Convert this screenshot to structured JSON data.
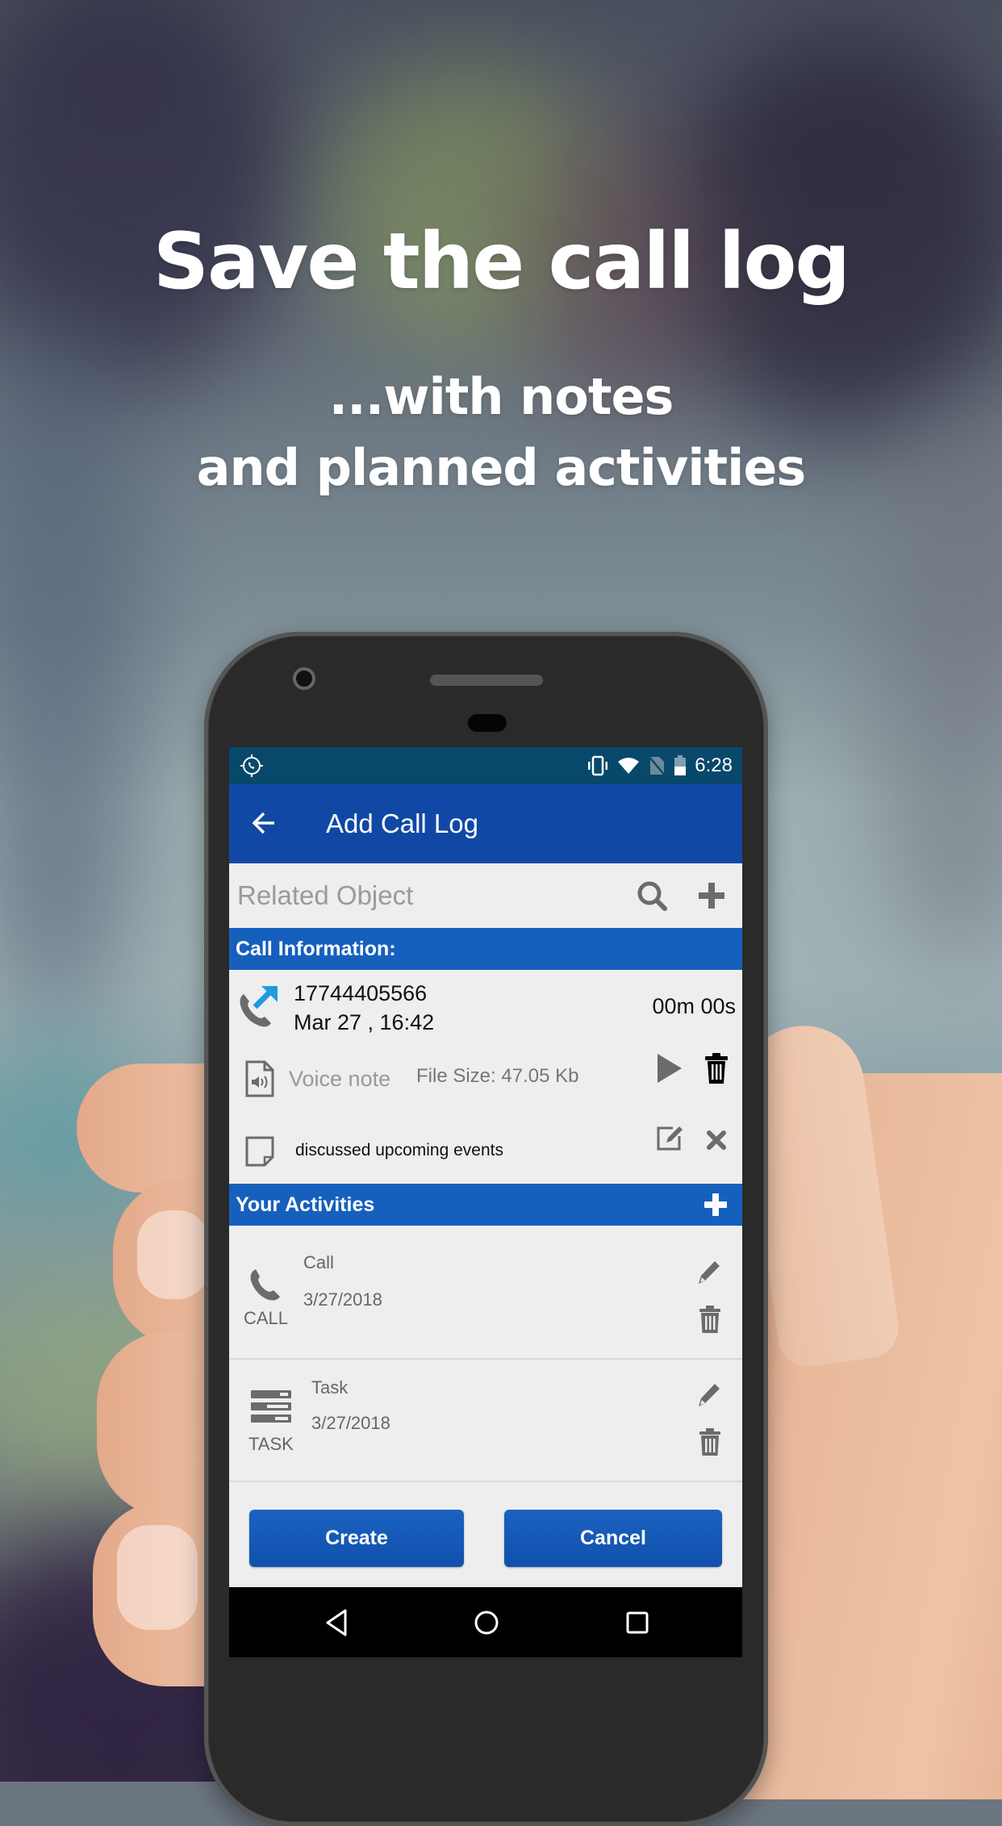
{
  "promo": {
    "headline": "Save the call log",
    "subline_1": "...with notes",
    "subline_2": "and planned activities"
  },
  "status_bar": {
    "left_icon": "call-recorder-icon",
    "icons": [
      "vibrate-icon",
      "wifi-icon",
      "no-sim-icon",
      "battery-icon"
    ],
    "time": "6:28"
  },
  "app_bar": {
    "back_icon": "arrow-left-icon",
    "title": "Add Call Log"
  },
  "related_object": {
    "placeholder": "Related Object",
    "value": "",
    "search_icon": "search-icon",
    "add_icon": "plus-icon"
  },
  "call_information": {
    "header": "Call Information:",
    "call_icon": "outgoing-call-icon",
    "phone_number": "17744405566",
    "date_time": "Mar 27 , 16:42",
    "duration": "00m 00s",
    "voice_note": {
      "label": "Voice note",
      "file_size": "File Size: 47.05 Kb"
    },
    "note": {
      "text": "discussed upcoming events"
    }
  },
  "activities": {
    "header": "Your Activities",
    "items": [
      {
        "type_label": "CALL",
        "name": "Call",
        "date": "3/27/2018",
        "icon": "phone-icon"
      },
      {
        "type_label": "TASK",
        "name": "Task",
        "date": "3/27/2018",
        "icon": "task-list-icon"
      }
    ]
  },
  "actions": {
    "create_label": "Create",
    "cancel_label": "Cancel"
  },
  "colors": {
    "status_bar": "#08486b",
    "app_bar": "#1148a5",
    "section_header": "#1660bd",
    "button": "#1459b8",
    "screen_bg": "#eeeeee",
    "call_arrow": "#1e9be0"
  }
}
